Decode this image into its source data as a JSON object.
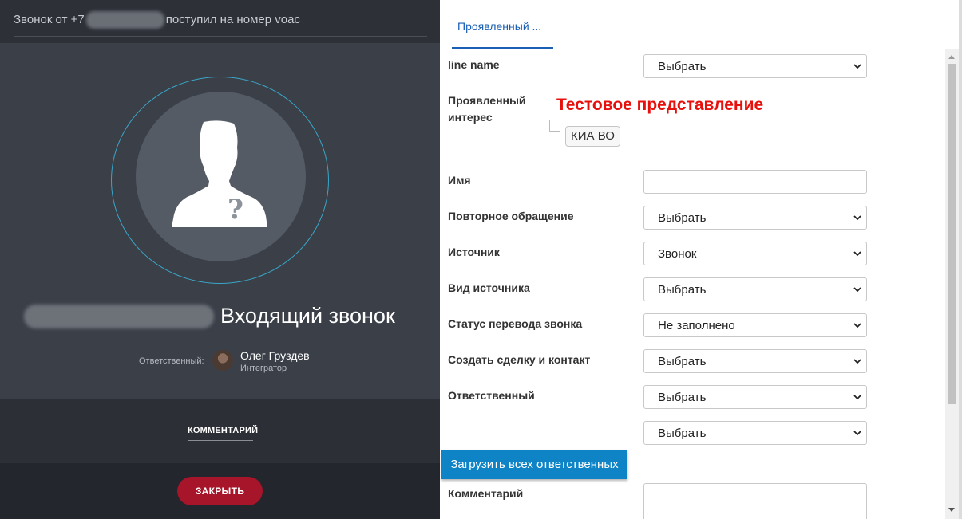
{
  "call_panel": {
    "title_prefix": "Звонок от +7",
    "title_suffix": "поступил на номер voac",
    "status": "Входящий звонок",
    "responsible_label": "Ответственный:",
    "responsible_name": "Олег Груздев",
    "responsible_role": "Интегратор",
    "comment_tab": "КОММЕНТАРИЙ",
    "close_button": "ЗАКРЫТЬ",
    "avatar_icon": "unknown-person-icon",
    "colors": {
      "accent_ring": "#3aa6c7",
      "close_button": "#a61529"
    }
  },
  "form_panel": {
    "tab_label": "Проявленный ...",
    "test_view_text": "Тестовое представление",
    "load_button": "Загрузить всех ответственных",
    "fields": {
      "line_name": {
        "label": "line name",
        "value": "Выбрать"
      },
      "interest": {
        "label_line1": "Проявленный",
        "label_line2": "интерес",
        "tag": "КИА ВО"
      },
      "name": {
        "label": "Имя",
        "value": ""
      },
      "repeat": {
        "label": "Повторное обращение",
        "value": "Выбрать"
      },
      "source": {
        "label": "Источник",
        "value": "Звонок"
      },
      "source_type": {
        "label": "Вид источника",
        "value": "Выбрать"
      },
      "transfer_status": {
        "label": "Статус перевода звонка",
        "value": "Не заполнено"
      },
      "create_deal": {
        "label": "Создать сделку и контакт",
        "value": "Выбрать"
      },
      "responsible": {
        "label": "Ответственный",
        "value": "Выбрать"
      },
      "responsible_extra": {
        "value": "Выбрать"
      },
      "comment": {
        "label": "Комментарий",
        "value": ""
      }
    },
    "colors": {
      "tab_accent": "#1a5fb4",
      "test_view": "#e8100c",
      "load_button": "#0e84c7"
    }
  }
}
